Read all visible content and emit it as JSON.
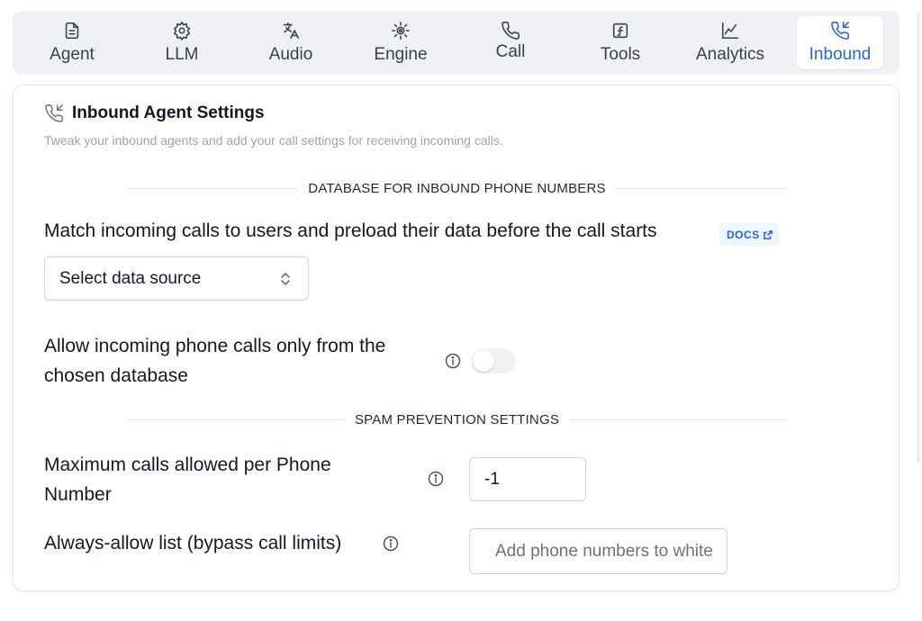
{
  "tabs": [
    {
      "label": "Agent",
      "icon": "document-icon",
      "active": false
    },
    {
      "label": "LLM",
      "icon": "llm-gear-icon",
      "active": false
    },
    {
      "label": "Audio",
      "icon": "translate-icon",
      "active": false
    },
    {
      "label": "Engine",
      "icon": "cog-icon",
      "active": false
    },
    {
      "label": "Call",
      "icon": "phone-icon",
      "active": false
    },
    {
      "label": "Tools",
      "icon": "function-icon",
      "active": false
    },
    {
      "label": "Analytics",
      "icon": "chart-line-icon",
      "active": false
    },
    {
      "label": "Inbound",
      "icon": "phone-incoming-icon",
      "active": true
    }
  ],
  "card": {
    "title": "Inbound Agent Settings",
    "subtitle": "Tweak your inbound agents and add your call settings for receiving incoming calls.",
    "section_database": "DATABASE FOR INBOUND PHONE NUMBERS",
    "match_title": "Match incoming calls to users and preload their data before the call starts",
    "docs_label": "DOCS",
    "select_value": "Select data source",
    "allow_label_line1": "Allow incoming phone calls only from the",
    "allow_label_line2": "chosen database",
    "allow_toggle_on": false,
    "section_spam": "SPAM PREVENTION SETTINGS",
    "max_calls_line1": "Maximum calls allowed per Phone",
    "max_calls_line2": "Number",
    "max_calls_value": "-1",
    "always_allow_label": "Always-allow list (bypass call limits)",
    "always_allow_placeholder": "Add phone numbers to whitelist"
  },
  "colors": {
    "accent": "#2563eb",
    "tabbar_bg": "#eef0f3"
  }
}
